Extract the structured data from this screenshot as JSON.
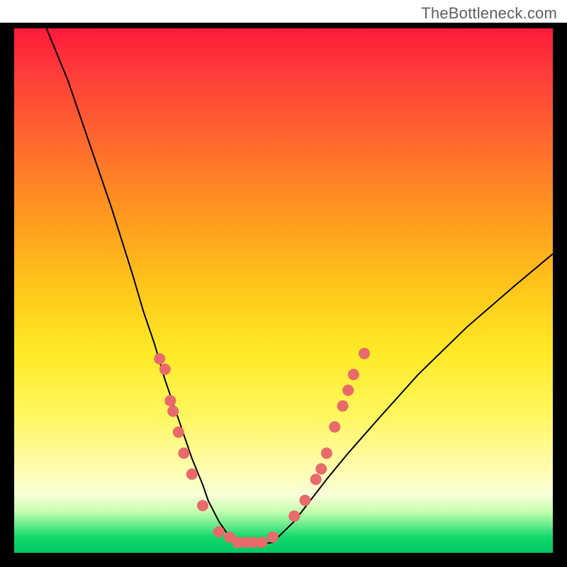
{
  "watermark": "TheBottleneck.com",
  "colors": {
    "page_bg": "#ffffff",
    "frame_bg": "#000000",
    "curve": "#000000",
    "dot": "#e86a6a",
    "gradient_top": "#ff1a3a",
    "gradient_bottom": "#00c864"
  },
  "chart_data": {
    "type": "line",
    "title": "",
    "xlabel": "",
    "ylabel": "",
    "xlim": [
      0,
      100
    ],
    "ylim": [
      0,
      100
    ],
    "grid": false,
    "legend": false,
    "curve": {
      "x": [
        6,
        10,
        14,
        18,
        22,
        24,
        26,
        28,
        30,
        32,
        33,
        35,
        36,
        37,
        38,
        40,
        42,
        43,
        45,
        48,
        50,
        52,
        55,
        58,
        62,
        68,
        75,
        84,
        93,
        100
      ],
      "y": [
        100,
        90,
        78,
        66,
        53,
        46,
        40,
        33,
        27,
        21,
        18,
        13,
        10,
        8,
        6,
        3,
        2,
        1.5,
        1.5,
        2,
        4,
        6,
        10,
        14,
        19,
        26,
        34,
        43,
        51,
        57
      ]
    },
    "dots": [
      {
        "x": 27,
        "y": 37
      },
      {
        "x": 28,
        "y": 35
      },
      {
        "x": 29,
        "y": 29
      },
      {
        "x": 29.5,
        "y": 27
      },
      {
        "x": 30.5,
        "y": 23
      },
      {
        "x": 31.5,
        "y": 19
      },
      {
        "x": 33,
        "y": 15
      },
      {
        "x": 35,
        "y": 9
      },
      {
        "x": 38,
        "y": 4
      },
      {
        "x": 40,
        "y": 3
      },
      {
        "x": 41.5,
        "y": 2
      },
      {
        "x": 43,
        "y": 2
      },
      {
        "x": 44.5,
        "y": 2
      },
      {
        "x": 46,
        "y": 2
      },
      {
        "x": 48,
        "y": 3
      },
      {
        "x": 52,
        "y": 7
      },
      {
        "x": 54,
        "y": 10
      },
      {
        "x": 56,
        "y": 14
      },
      {
        "x": 57,
        "y": 16
      },
      {
        "x": 58,
        "y": 19
      },
      {
        "x": 59.5,
        "y": 24
      },
      {
        "x": 61,
        "y": 28
      },
      {
        "x": 62,
        "y": 31
      },
      {
        "x": 63,
        "y": 34
      },
      {
        "x": 65,
        "y": 38
      }
    ]
  }
}
